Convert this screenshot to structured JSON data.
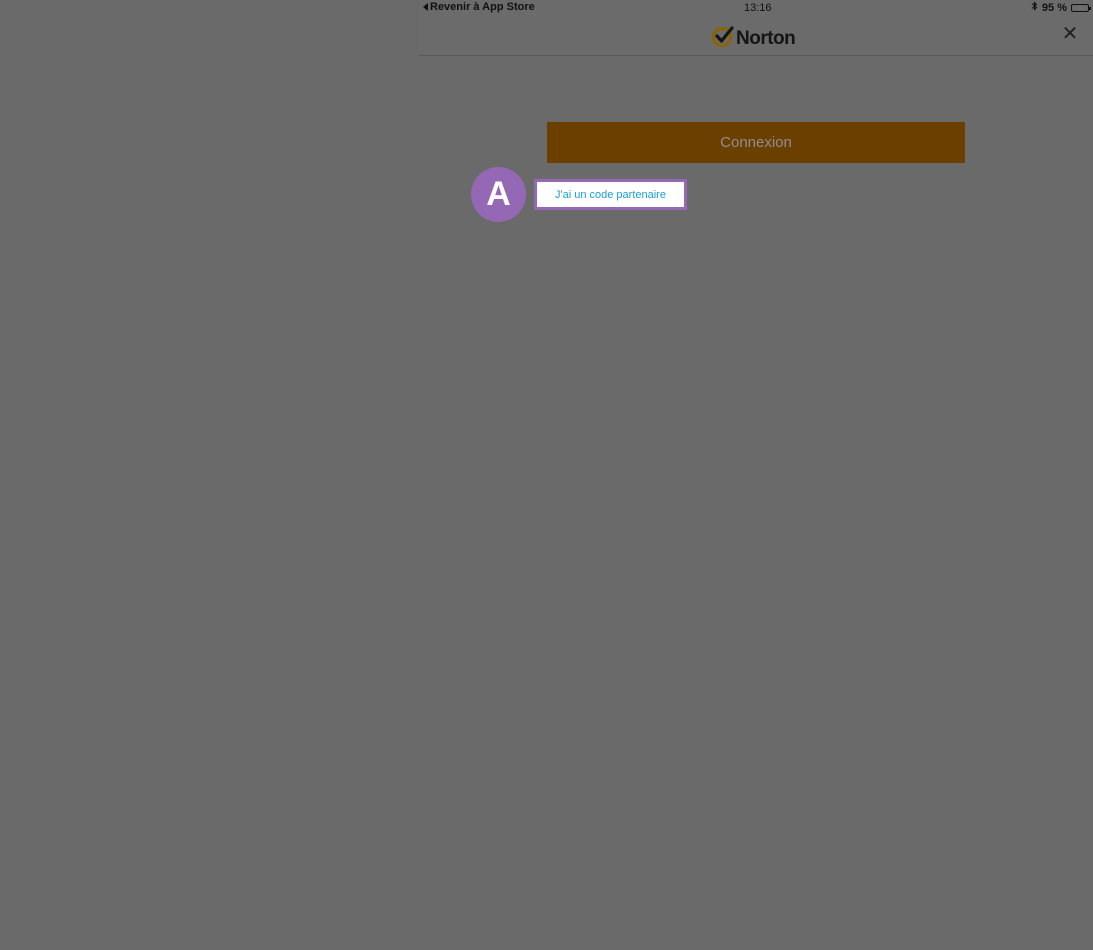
{
  "status_bar": {
    "back_label": "Revenir à App Store",
    "time": "13:16",
    "battery_text": "95 %",
    "battery_level": 0.95
  },
  "nav": {
    "logo_text": "Norton",
    "close_symbol": "✕"
  },
  "main": {
    "connexion_label": "Connexion",
    "partner_link_label": "J'ai un code partenaire"
  },
  "callout": {
    "label": "A"
  },
  "colors": {
    "background": "#6a6a6a",
    "connexion_bg": "#6b3f00",
    "link": "#1a9fd8",
    "callout": "#9468b4"
  },
  "icons": {
    "back": "back-triangle-icon",
    "bluetooth": "bluetooth-icon",
    "battery": "battery-icon",
    "logo_check": "norton-check-icon",
    "close": "close-icon"
  }
}
